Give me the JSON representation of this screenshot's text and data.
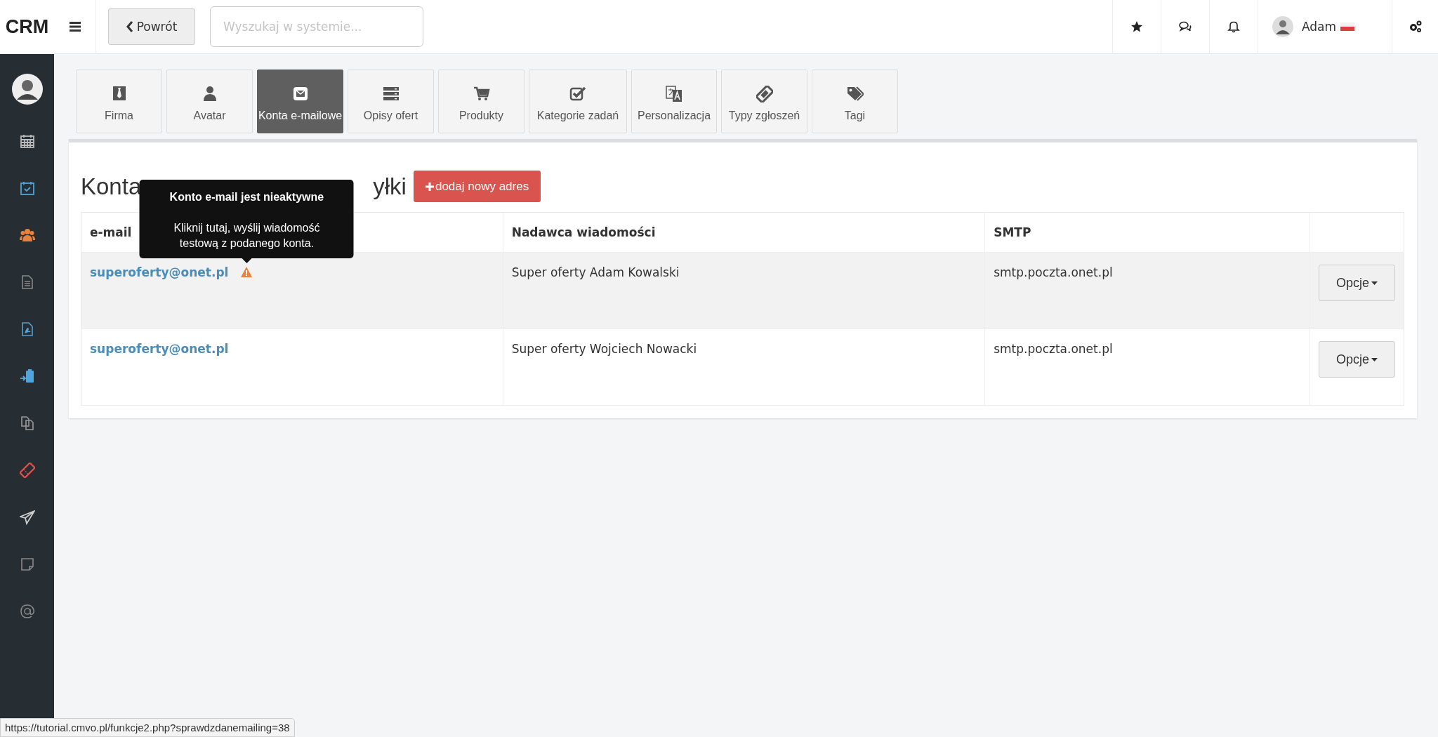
{
  "header": {
    "logo": "CRM",
    "back_button": "Powrót",
    "search": {
      "placeholder": "Wyszukaj w systemie..."
    },
    "user": {
      "name": "Adam"
    }
  },
  "tabs": [
    {
      "label": "Firma",
      "selected": false
    },
    {
      "label": "Avatar",
      "selected": false
    },
    {
      "label": "Konta e-mailowe",
      "selected": true
    },
    {
      "label": "Opisy ofert",
      "selected": false
    },
    {
      "label": "Produkty",
      "selected": false
    },
    {
      "label": "Kategorie zadań",
      "selected": false
    },
    {
      "label": "Personalizacja",
      "selected": false
    },
    {
      "label": "Typy zgłoszeń",
      "selected": false
    },
    {
      "label": "Tagi",
      "selected": false
    }
  ],
  "section": {
    "title_parts": [
      "Konta",
      "yłki"
    ],
    "add_button": "dodaj nowy adres"
  },
  "table": {
    "columns": [
      "e-mail",
      "Nadawca wiadomości",
      "SMTP"
    ],
    "rows": [
      {
        "email": "superoferty@onet.pl",
        "inactive": true,
        "highlighted": true,
        "sender": "Super oferty Adam Kowalski",
        "smtp": "smtp.poczta.onet.pl",
        "options": "Opcje"
      },
      {
        "email": "superoferty@onet.pl",
        "inactive": false,
        "highlighted": false,
        "sender": "Super oferty Wojciech Nowacki",
        "smtp": "smtp.poczta.onet.pl",
        "options": "Opcje"
      }
    ]
  },
  "tooltip": {
    "title": "Konto e-mail jest nieaktywne",
    "text": "Kliknij tutaj, wyślij wiadomość testową z podanego konta."
  },
  "status_url": "https://tutorial.cmvo.pl/funkcje2.php?sprawdzdanemailing=38"
}
